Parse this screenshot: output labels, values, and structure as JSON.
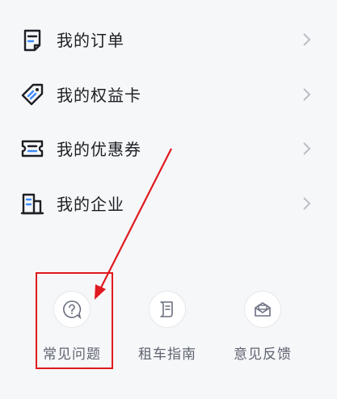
{
  "menu": {
    "items": [
      {
        "label": "我的订单",
        "icon": "order-list-icon"
      },
      {
        "label": "我的权益卡",
        "icon": "tag-icon"
      },
      {
        "label": "我的优惠券",
        "icon": "coupon-icon"
      },
      {
        "label": "我的企业",
        "icon": "building-icon"
      }
    ]
  },
  "shortcuts": [
    {
      "label": "常见问题",
      "icon": "question-icon"
    },
    {
      "label": "租车指南",
      "icon": "guide-scroll-icon"
    },
    {
      "label": "意见反馈",
      "icon": "feedback-envelope-icon"
    }
  ],
  "colors": {
    "background": "#f6f7f9",
    "text": "#1d1f24",
    "icon_accent": "#3d8bfd",
    "annotation": "#e0191f"
  }
}
